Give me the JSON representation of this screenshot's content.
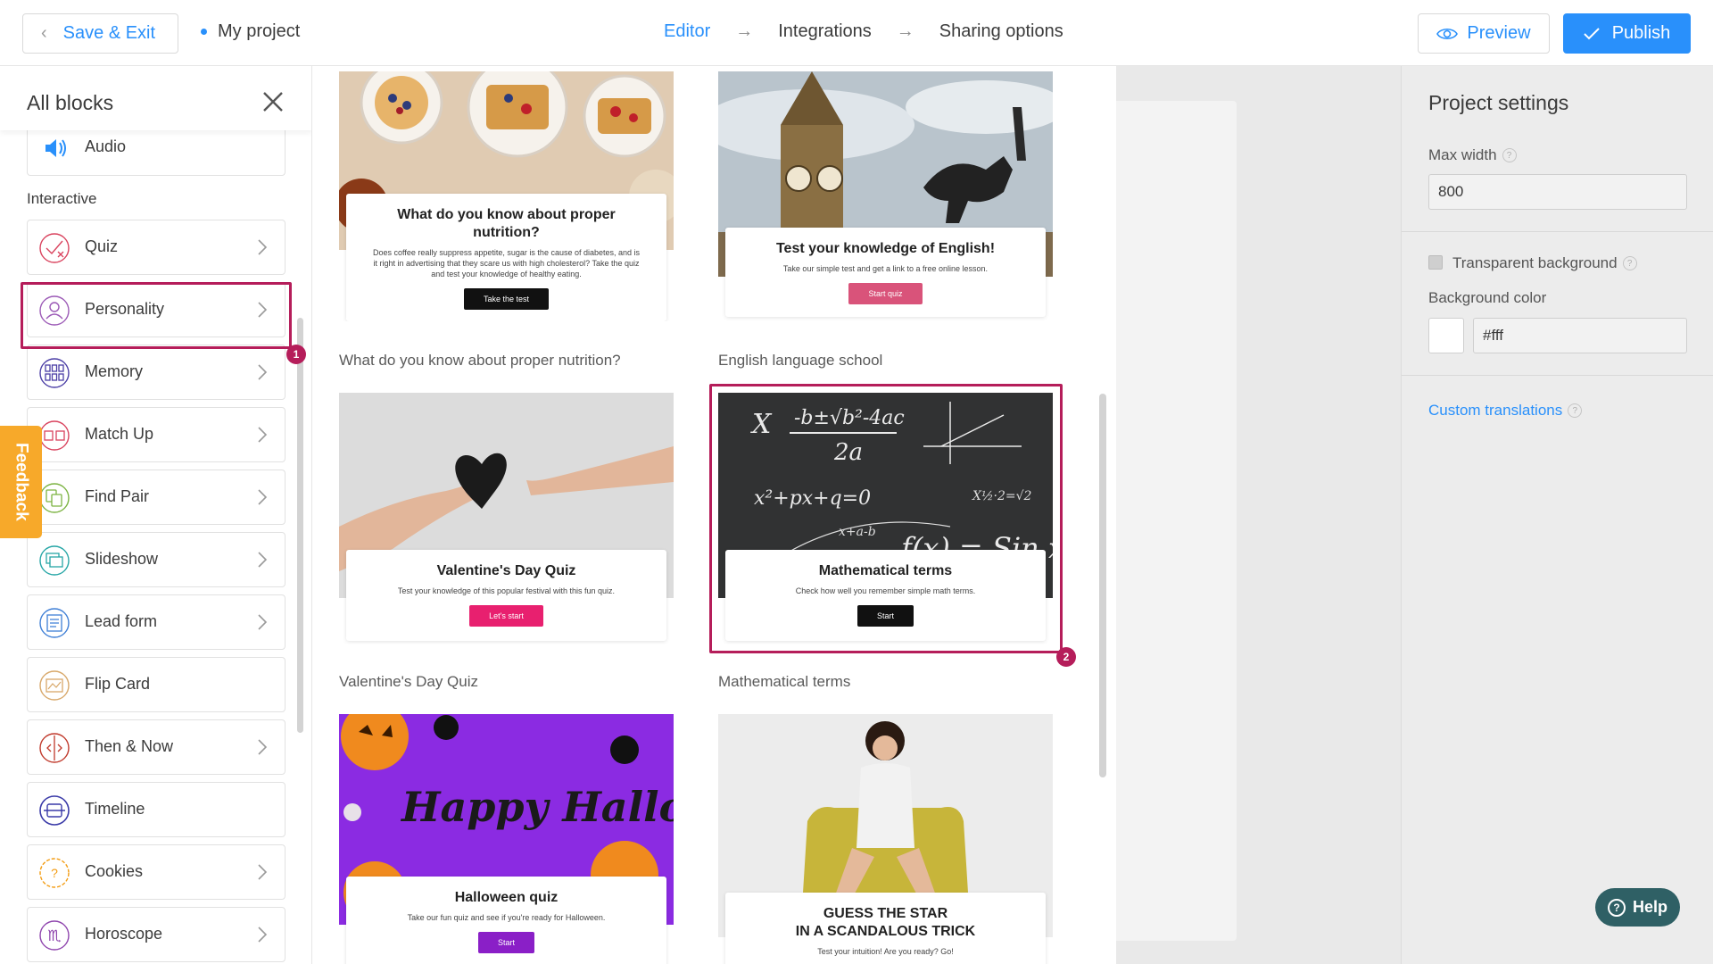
{
  "topbar": {
    "save_label": "Save & Exit",
    "project_name": "My project",
    "steps": [
      "Editor",
      "Integrations",
      "Sharing options"
    ],
    "active_step": "Editor",
    "preview_label": "Preview",
    "publish_label": "Publish",
    "accent": "#2990fb"
  },
  "sidebar": {
    "title": "All blocks",
    "top_item": "Audio",
    "section": "Interactive",
    "items": [
      {
        "label": "Quiz",
        "icon": "quiz-icon",
        "color": "#d9425d"
      },
      {
        "label": "Personality",
        "icon": "personality-icon",
        "color": "#9b59b6"
      },
      {
        "label": "Memory",
        "icon": "memory-icon",
        "color": "#4b3ea6"
      },
      {
        "label": "Match Up",
        "icon": "match-up-icon",
        "color": "#d9425d"
      },
      {
        "label": "Find Pair",
        "icon": "find-pair-icon",
        "color": "#7cb342"
      },
      {
        "label": "Slideshow",
        "icon": "slideshow-icon",
        "color": "#26a6a6"
      },
      {
        "label": "Lead form",
        "icon": "lead-form-icon",
        "color": "#3f7fd6"
      },
      {
        "label": "Flip Card",
        "icon": "flip-card-icon",
        "color": "#d8a86a"
      },
      {
        "label": "Then & Now",
        "icon": "then-now-icon",
        "color": "#c0392b"
      },
      {
        "label": "Timeline",
        "icon": "timeline-icon",
        "color": "#3a3aa8"
      },
      {
        "label": "Cookies",
        "icon": "cookies-icon",
        "color": "#f39c12"
      },
      {
        "label": "Horoscope",
        "icon": "horoscope-icon",
        "color": "#8e44ad"
      }
    ],
    "badge1": "1",
    "feedback_label": "Feedback"
  },
  "gallery": {
    "cards": [
      {
        "title": "What do you know about proper nutrition?",
        "desc": "Does coffee really suppress appetite, sugar is the cause of diabetes, and is it right in advertising that they scare us with high cholesterol? Take the quiz and test your knowledge of healthy eating.",
        "button": "Take the test",
        "btn_color": "#111111",
        "caption": "What do you know about proper nutrition?"
      },
      {
        "title": "Test your knowledge of English!",
        "desc": "Take our simple test and get a link to a free online lesson.",
        "button": "Start quiz",
        "btn_color": "#d9537a",
        "caption": "English language school"
      },
      {
        "title": "Valentine's Day Quiz",
        "desc": "Test your knowledge of this popular festival with this fun quiz.",
        "button": "Let's start",
        "btn_color": "#e8206f",
        "caption": "Valentine's Day Quiz"
      },
      {
        "title": "Mathematical terms",
        "desc": "Check how well you remember simple math terms.",
        "button": "Start",
        "btn_color": "#111111",
        "caption": "Mathematical terms"
      },
      {
        "title": "Halloween quiz",
        "desc": "Take our fun quiz and see if you're ready for Halloween.",
        "button": "Start",
        "btn_color": "#8a1fc7"
      },
      {
        "title": "GUESS THE STAR\nIN A SCANDALOUS TRICK",
        "desc": "Test your intuition! Are you ready? Go!"
      }
    ],
    "halloween_text": "Happy Halloween",
    "badge2": "2"
  },
  "settings": {
    "title": "Project settings",
    "max_width_label": "Max width",
    "max_width_value": "800",
    "transparent_label": "Transparent background",
    "bg_color_label": "Background color",
    "bg_color_value": "#fff",
    "custom_translations": "Custom translations",
    "help_label": "Help"
  }
}
